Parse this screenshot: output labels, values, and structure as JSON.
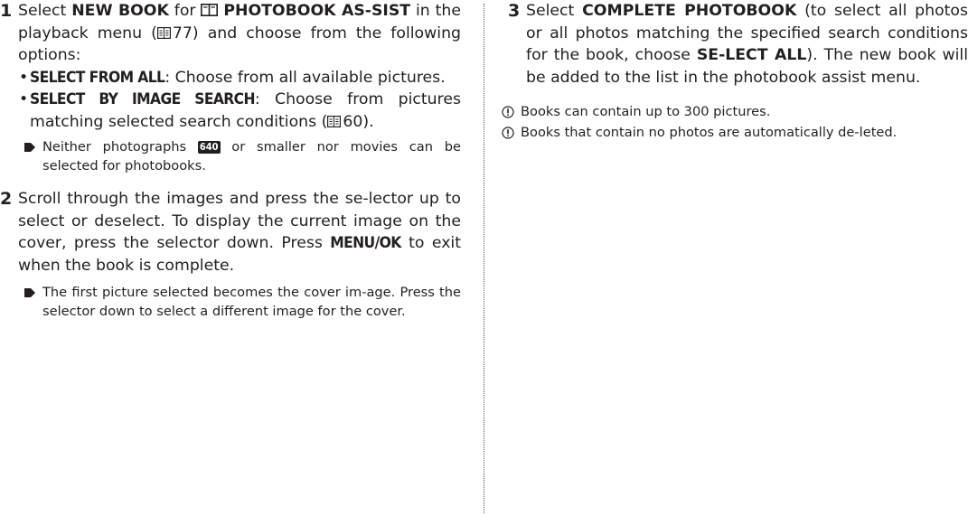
{
  "left": {
    "step1": {
      "number": "1",
      "t1": "Select ",
      "new_book": "NEW BOOK",
      "t2": " for ",
      "photobook_assist": "PHOTOBOOK AS-SIST",
      "t3": " in the playback menu (",
      "ref_page": "77",
      "t4": ") and choose from the following options:",
      "options": [
        {
          "key": "SELECT FROM ALL",
          "text": ": Choose from all available pictures."
        },
        {
          "key": "SELECT BY IMAGE SEARCH",
          "text": ": Choose from pictures matching selected search conditions (",
          "ref_page": "60",
          "text_end": ")."
        }
      ],
      "note_a": "Neither photographs ",
      "note_badge": "640",
      "note_b": " or smaller nor movies can be selected for photobooks."
    },
    "step2": {
      "number": "2",
      "t1": "Scroll through the images and press the se-lector up to select or deselect. To display the current image on the cover, press the selector down. Press ",
      "menu_ok": "MENU/OK",
      "t2": " to exit when the book is complete.",
      "note": "The first picture selected becomes the cover im-age. Press the selector down to select a different image for the cover."
    }
  },
  "right": {
    "step3": {
      "number": "3",
      "t1": "Select ",
      "complete": "COMPLETE PHOTOBOOK",
      "t2": " (to select all photos or all photos matching the specified search conditions for the book, choose ",
      "select_all": "SE-LECT ALL",
      "t3": "). The new book will be added to the list in the photobook assist menu."
    },
    "cautions": [
      "Books can contain up to 300 pictures.",
      "Books that contain no photos are automatically de-leted."
    ]
  }
}
